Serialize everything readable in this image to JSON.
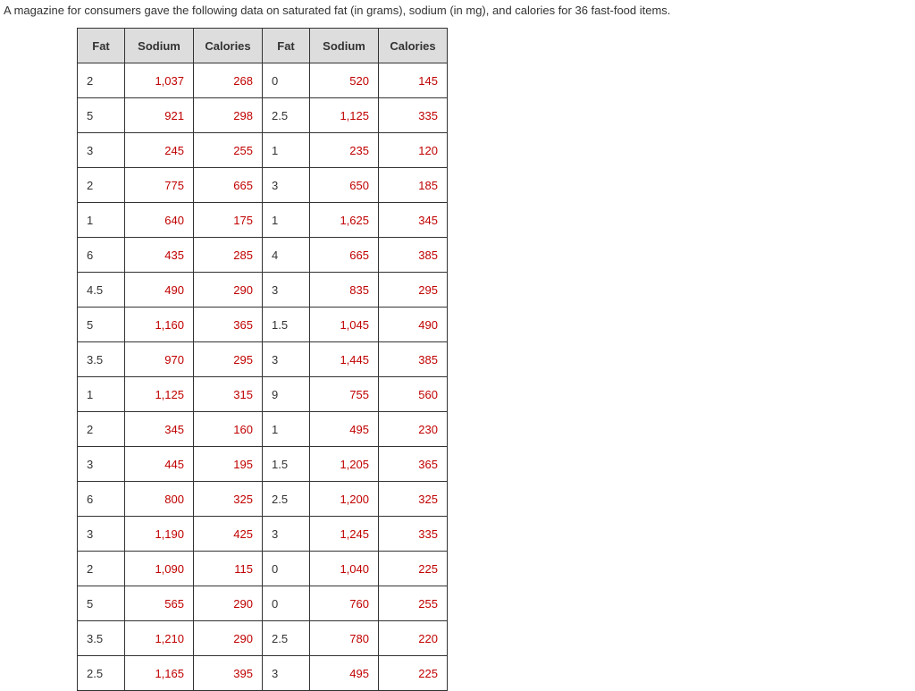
{
  "intro": "A magazine for consumers gave the following data on saturated fat (in grams), sodium (in mg), and calories for 36 fast-food items.",
  "headers": {
    "fat": "Fat",
    "sodium": "Sodium",
    "calories": "Calories"
  },
  "rows": [
    {
      "fat1": "2",
      "sodium1": "1,037",
      "calories1": "268",
      "fat2": "0",
      "sodium2": "520",
      "calories2": "145"
    },
    {
      "fat1": "5",
      "sodium1": "921",
      "calories1": "298",
      "fat2": "2.5",
      "sodium2": "1,125",
      "calories2": "335"
    },
    {
      "fat1": "3",
      "sodium1": "245",
      "calories1": "255",
      "fat2": "1",
      "sodium2": "235",
      "calories2": "120"
    },
    {
      "fat1": "2",
      "sodium1": "775",
      "calories1": "665",
      "fat2": "3",
      "sodium2": "650",
      "calories2": "185"
    },
    {
      "fat1": "1",
      "sodium1": "640",
      "calories1": "175",
      "fat2": "1",
      "sodium2": "1,625",
      "calories2": "345"
    },
    {
      "fat1": "6",
      "sodium1": "435",
      "calories1": "285",
      "fat2": "4",
      "sodium2": "665",
      "calories2": "385"
    },
    {
      "fat1": "4.5",
      "sodium1": "490",
      "calories1": "290",
      "fat2": "3",
      "sodium2": "835",
      "calories2": "295"
    },
    {
      "fat1": "5",
      "sodium1": "1,160",
      "calories1": "365",
      "fat2": "1.5",
      "sodium2": "1,045",
      "calories2": "490"
    },
    {
      "fat1": "3.5",
      "sodium1": "970",
      "calories1": "295",
      "fat2": "3",
      "sodium2": "1,445",
      "calories2": "385"
    },
    {
      "fat1": "1",
      "sodium1": "1,125",
      "calories1": "315",
      "fat2": "9",
      "sodium2": "755",
      "calories2": "560"
    },
    {
      "fat1": "2",
      "sodium1": "345",
      "calories1": "160",
      "fat2": "1",
      "sodium2": "495",
      "calories2": "230"
    },
    {
      "fat1": "3",
      "sodium1": "445",
      "calories1": "195",
      "fat2": "1.5",
      "sodium2": "1,205",
      "calories2": "365"
    },
    {
      "fat1": "6",
      "sodium1": "800",
      "calories1": "325",
      "fat2": "2.5",
      "sodium2": "1,200",
      "calories2": "325"
    },
    {
      "fat1": "3",
      "sodium1": "1,190",
      "calories1": "425",
      "fat2": "3",
      "sodium2": "1,245",
      "calories2": "335"
    },
    {
      "fat1": "2",
      "sodium1": "1,090",
      "calories1": "115",
      "fat2": "0",
      "sodium2": "1,040",
      "calories2": "225"
    },
    {
      "fat1": "5",
      "sodium1": "565",
      "calories1": "290",
      "fat2": "0",
      "sodium2": "760",
      "calories2": "255"
    },
    {
      "fat1": "3.5",
      "sodium1": "1,210",
      "calories1": "290",
      "fat2": "2.5",
      "sodium2": "780",
      "calories2": "220"
    },
    {
      "fat1": "2.5",
      "sodium1": "1,165",
      "calories1": "395",
      "fat2": "3",
      "sodium2": "495",
      "calories2": "225"
    }
  ]
}
